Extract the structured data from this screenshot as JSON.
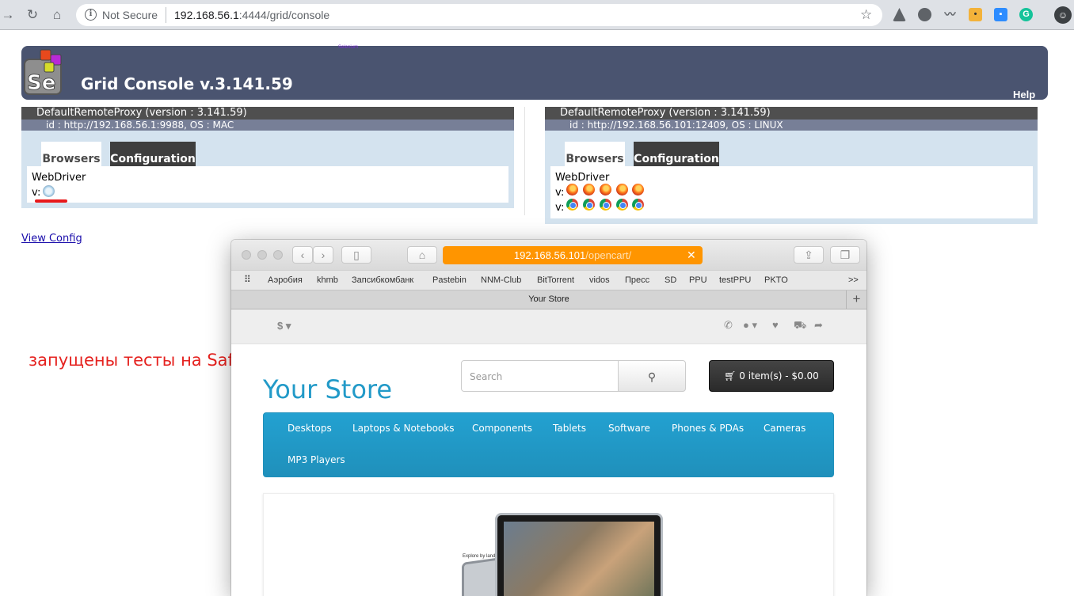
{
  "chrome": {
    "security_label": "Not Secure",
    "url_host": "192.168.56.1",
    "url_rest": ":4444/grid/console",
    "back_icon": "back-arrow-icon",
    "reload_icon": "reload-icon",
    "home_icon": "home-icon",
    "star_icon": "star-icon"
  },
  "grid": {
    "title": "Grid Console v.3.141.59",
    "tiny_text": "Selenium",
    "help": "Help",
    "view_config": "View Config",
    "proxies": [
      {
        "title": "DefaultRemoteProxy (version : 3.141.59)",
        "id": "id : http://192.168.56.1:9988, OS : MAC",
        "tab_browsers": "Browsers",
        "tab_config": "Configuration",
        "driver": "WebDriver",
        "rows": [
          {
            "label": "v:",
            "browser": "safari",
            "count": 1
          }
        ]
      },
      {
        "title": "DefaultRemoteProxy (version : 3.141.59)",
        "id": "id : http://192.168.56.101:12409, OS : LINUX",
        "tab_browsers": "Browsers",
        "tab_config": "Configuration",
        "driver": "WebDriver",
        "rows": [
          {
            "label": "v:",
            "browser": "firefox",
            "count": 5
          },
          {
            "label": "v:",
            "browser": "chrome",
            "count": 5
          }
        ]
      }
    ]
  },
  "annotation": "запущены тесты на Safari локально",
  "safari": {
    "url_host": "192.168.56.101",
    "url_path": "/opencart/",
    "favorites": [
      "Аэробия",
      "khmb",
      "Запсибкомбанк",
      "Pastebin",
      "NNM-Club",
      "BitTorrent",
      "vidos",
      "Пресс",
      "SD",
      "PPU",
      "testPPU",
      "PKTO"
    ],
    "more": ">>",
    "tab_title": "Your Store",
    "new_tab": "+"
  },
  "opencart": {
    "currency": "$",
    "store_name": "Your Store",
    "search_placeholder": "Search",
    "cart": "0 item(s) - $0.00",
    "menu": [
      "Desktops",
      "Laptops & Notebooks",
      "Components",
      "Tablets",
      "Software",
      "Phones & PDAs",
      "Cameras",
      "MP3 Players"
    ],
    "slide_caption": "Explore by land."
  },
  "colors": {
    "grid_header": "#4a5470",
    "safari_url_bar": "#ff9500",
    "opencart_blue": "#229ac8",
    "annotation_red": "#e5221f"
  }
}
